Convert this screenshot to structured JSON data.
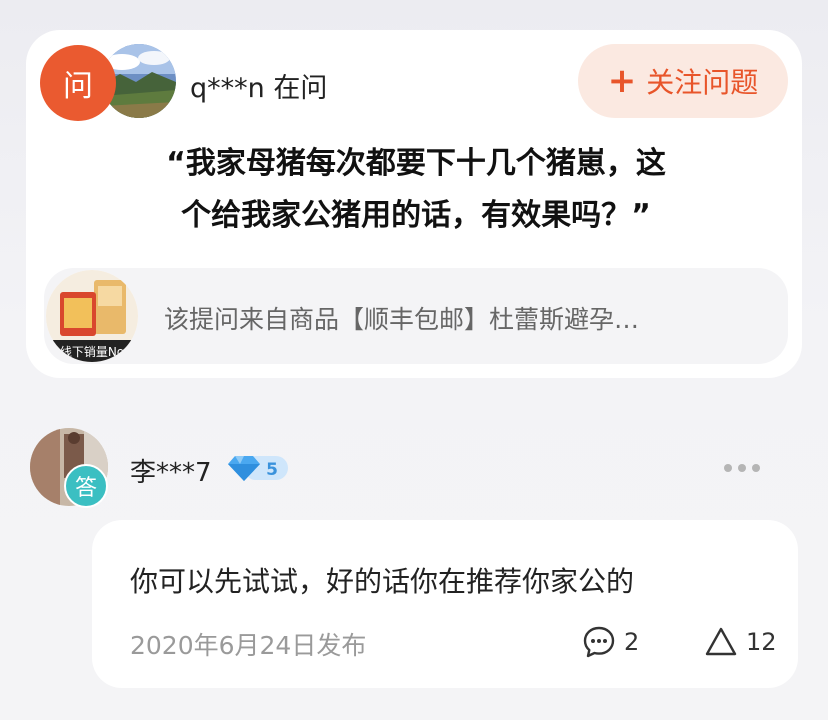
{
  "question_card": {
    "badge": "问",
    "asker": "q***n 在问",
    "follow_button": {
      "icon": "plus-icon",
      "label": "关注问题"
    },
    "question_line1": "“我家母猪每次都要下十几个猪崽，这",
    "question_line2": "个给我家公猪用的话，有效果吗？”",
    "product": {
      "thumb_caption": "线下销量No",
      "text": "该提问来自商品【顺丰包邮】杜蕾斯避孕…"
    }
  },
  "answer": {
    "badge": "答",
    "user_name": "李***7",
    "level": "5",
    "text": "你可以先试试，好的话你在推荐你家公的",
    "date": "2020年6月24日发布",
    "comment_count": "2",
    "like_count": "12"
  },
  "colors": {
    "accent": "#ea5a30",
    "follow_bg": "#fbe9e1",
    "answer_badge": "#3bbfc2",
    "level_badge": "#4aa8f0"
  }
}
